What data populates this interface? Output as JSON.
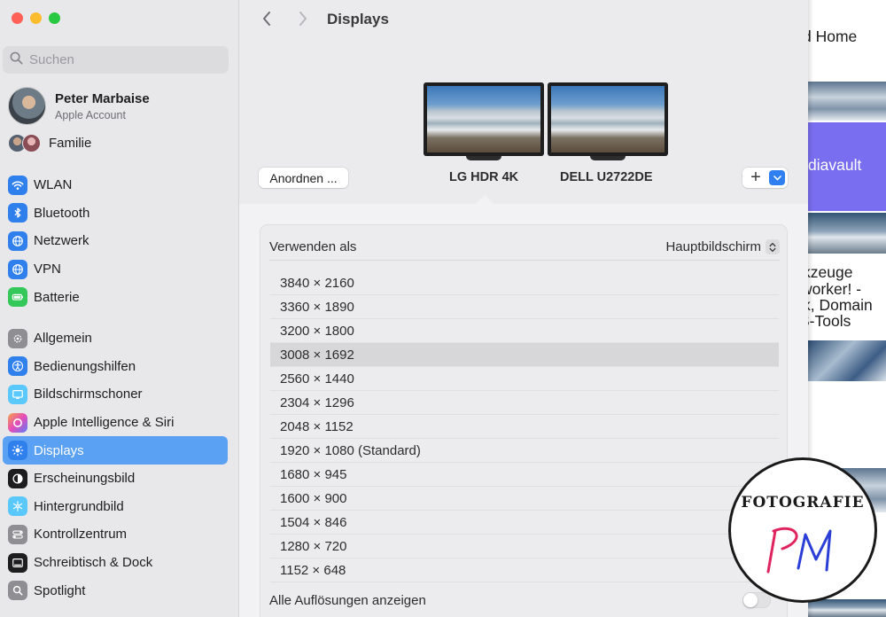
{
  "window": {
    "title": "Displays"
  },
  "search": {
    "placeholder": "Suchen"
  },
  "account": {
    "name": "Peter Marbaise",
    "subtitle": "Apple Account",
    "family_label": "Familie"
  },
  "sidebar": {
    "groups": [
      [
        {
          "label": "WLAN",
          "icon": "wifi-icon",
          "color": "#2f80ed"
        },
        {
          "label": "Bluetooth",
          "icon": "bluetooth-icon",
          "color": "#2f80ed"
        },
        {
          "label": "Netzwerk",
          "icon": "globe-icon",
          "color": "#2f80ed"
        },
        {
          "label": "VPN",
          "icon": "vpn-globe-icon",
          "color": "#2f80ed"
        },
        {
          "label": "Batterie",
          "icon": "battery-icon",
          "color": "#34c759"
        }
      ],
      [
        {
          "label": "Allgemein",
          "icon": "gear-icon",
          "color": "#8e8e93"
        },
        {
          "label": "Bedienungshilfen",
          "icon": "accessibility-icon",
          "color": "#2f80ed"
        },
        {
          "label": "Bildschirmschoner",
          "icon": "screensaver-icon",
          "color": "#5ac8fa"
        },
        {
          "label": "Apple Intelligence & Siri",
          "icon": "siri-icon",
          "color": "#e46adf"
        },
        {
          "label": "Displays",
          "icon": "sun-icon",
          "color": "#2f80ed",
          "selected": true
        },
        {
          "label": "Erscheinungsbild",
          "icon": "appearance-icon",
          "color": "#1d1d1f"
        },
        {
          "label": "Hintergrundbild",
          "icon": "snowflake-icon",
          "color": "#5ac8fa"
        },
        {
          "label": "Kontrollzentrum",
          "icon": "toggles-icon",
          "color": "#8e8e93"
        },
        {
          "label": "Schreibtisch & Dock",
          "icon": "dock-icon",
          "color": "#1d1d1f"
        },
        {
          "label": "Spotlight",
          "icon": "magnifier-icon",
          "color": "#8e8e93"
        }
      ]
    ]
  },
  "displays": {
    "arrange_label": "Anordnen ...",
    "monitors": [
      {
        "label": "LG HDR 4K"
      },
      {
        "label": "DELL U2722DE"
      }
    ],
    "add_label": "+"
  },
  "settings": {
    "use_as_label": "Verwenden als",
    "use_as_value": "Hauptbildschirm",
    "resolutions": [
      "3840 × 2160",
      "3360 × 1890",
      "3200 × 1800",
      "3008 × 1692",
      "2560 × 1440",
      "2304 × 1296",
      "2048 × 1152",
      "1920 × 1080 (Standard)",
      "1680 × 945",
      "1600 × 900",
      "1504 × 846",
      "1280 × 720",
      "1152 × 648"
    ],
    "selected_resolution": "3008 × 1692",
    "show_all_label": "Alle Auflösungen anzeigen",
    "show_all_enabled": false
  },
  "background_window": {
    "texts": [
      "d Home",
      "diavault",
      "kzeuge",
      "worker! -",
      "k, Domain",
      "S-Tools"
    ]
  },
  "watermark": {
    "text": "FOTOGRAFIE",
    "logo": "PM"
  }
}
